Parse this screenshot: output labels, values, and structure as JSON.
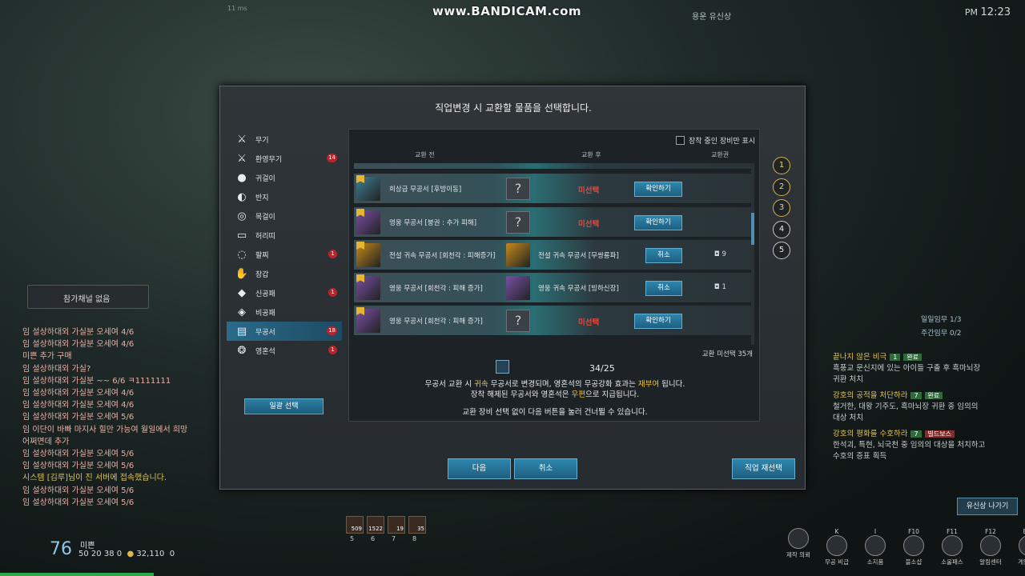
{
  "overlay": {
    "watermark": "www.BANDICAM.com",
    "zone": "용운 유신상",
    "clock": {
      "ampm": "PM",
      "time": "12:23"
    },
    "fps": "11 ms"
  },
  "chat": {
    "channel": "참가채널 없음",
    "lines": [
      {
        "text": "임 설상하대외 가실분 오세여 4/6",
        "type": "normal"
      },
      {
        "text": "임 설상하대외 가실분 오세여 4/6",
        "type": "normal"
      },
      {
        "text": "미쁜 추가 구매",
        "type": "normal"
      },
      {
        "text": "임 설상하대외 가실?",
        "type": "normal"
      },
      {
        "text": "임 설상하대외 가실분 ~~ 6/6 ㅋ1111111",
        "type": "normal"
      },
      {
        "text": "임 설상하대외 가실분 오세여 4/6",
        "type": "normal"
      },
      {
        "text": "임 설상하대외 가실분 오세여 4/6",
        "type": "normal"
      },
      {
        "text": "임 설상하대외 가실분 오세여 5/6",
        "type": "normal"
      },
      {
        "text": "임 이단이 바빠 마지사 힐만 가능여 월일에서 희망",
        "type": "normal"
      },
      {
        "text": "어쩌면데 추가",
        "type": "normal"
      },
      {
        "text": "임 설상하대외 가실분 오세여 5/6",
        "type": "normal"
      },
      {
        "text": "임 설상하대외 가실분 오세여 5/6",
        "type": "normal"
      },
      {
        "text": "시스템 [김루]님이 진 서버에 접속했습니다.",
        "type": "sys"
      },
      {
        "text": "임 설상하대외 가실분 오세여 5/6",
        "type": "normal"
      },
      {
        "text": "임 설상하대외 가실분 오세여 5/6",
        "type": "normal"
      }
    ]
  },
  "dialog": {
    "title": "직업변경 시 교환할 물품을 선택합니다.",
    "categories": [
      {
        "label": "무기",
        "icon": "sword-icon",
        "badge": ""
      },
      {
        "label": "환영무기",
        "icon": "phantom-sword-icon",
        "badge": "14"
      },
      {
        "label": "귀걸이",
        "icon": "earring-icon",
        "badge": ""
      },
      {
        "label": "반지",
        "icon": "ring-icon",
        "badge": ""
      },
      {
        "label": "목걸이",
        "icon": "necklace-icon",
        "badge": ""
      },
      {
        "label": "허리띠",
        "icon": "belt-icon",
        "badge": ""
      },
      {
        "label": "팔찌",
        "icon": "bracelet-icon",
        "badge": "1"
      },
      {
        "label": "장갑",
        "icon": "glove-icon",
        "badge": ""
      },
      {
        "label": "신공패",
        "icon": "talisman-icon",
        "badge": "1"
      },
      {
        "label": "비공패",
        "icon": "secret-talisman-icon",
        "badge": ""
      },
      {
        "label": "무공서",
        "icon": "book-icon",
        "badge": "18"
      },
      {
        "label": "영혼석",
        "icon": "soulstone-icon",
        "badge": "1"
      }
    ],
    "selected_category": "무공서",
    "bulk_select": "일괄 선택",
    "filter_label": "장착 중인 장비만 표시",
    "columns": {
      "before": "교환 전",
      "after": "교환 후",
      "ticket": "교환권"
    },
    "rows": [
      {
        "name": "희상급 무공서 [후방이동]",
        "before_color": "#3d7f96",
        "after_name": "",
        "after_color": "",
        "status": "미선택",
        "button": "확인하기",
        "ticket": ""
      },
      {
        "name": "영웅 무공서 [붕권 : 추가 피해]",
        "before_color": "#7a4fa6",
        "after_name": "",
        "after_color": "",
        "status": "미선택",
        "button": "확인하기",
        "ticket": ""
      },
      {
        "name": "전설 귀속 무공서 [회천각 : 피해증가]",
        "before_color": "#c48a1a",
        "after_name": "전설 귀속 무공서 [무쌍룡파]",
        "after_color": "#c48a1a",
        "status": "",
        "button": "취소",
        "ticket": "9"
      },
      {
        "name": "영웅 무공서 [회천각 : 피해 증가]",
        "before_color": "#7a4fa6",
        "after_name": "영웅 귀속 무공서 [빙하신장]",
        "after_color": "#7a4fa6",
        "status": "",
        "button": "취소",
        "ticket": "1"
      },
      {
        "name": "영웅 무공서 [회천각 : 피해 증가]",
        "before_color": "#7a4fa6",
        "after_name": "",
        "after_color": "",
        "status": "미선택",
        "button": "확인하기",
        "ticket": ""
      }
    ],
    "remaining": "교환 미선택 35개",
    "count": "34/25",
    "info": {
      "line1_a": "무공서 교환 시 ",
      "line1_b": "귀속",
      "line1_c": " 무공서로 변경되며, 영혼석의 무공강화 효과는 ",
      "line1_d": "재부여",
      "line1_e": " 됩니다.",
      "line2_a": "장착 해제된 무공서와 영혼석은 ",
      "line2_b": "우편",
      "line2_c": "으로 지급됩니다.",
      "line3": "교환 장비 선택 없이 다음 버튼을 눌러 건너뛸 수 있습니다."
    },
    "steps": [
      "1",
      "2",
      "3",
      "4",
      "5"
    ],
    "steps_done": [
      true,
      true,
      true,
      false,
      false
    ],
    "buttons": {
      "next": "다음",
      "cancel": "취소",
      "reselect": "직업 재선택"
    }
  },
  "quests": {
    "daily": "일일임무 1/3",
    "weekly": "주간임무 0/2",
    "items": [
      {
        "title": "끝나지 않은 비극",
        "tag": "1",
        "tag2": "완료",
        "desc1": "흑풍교 문신지에 있는 아이들 구출 후 흑마뇌장",
        "desc2": "귀환 처치"
      },
      {
        "title": "강호의 공적을 처단하라",
        "tag": "7",
        "tag2": "완료",
        "desc1": "철거한, 대왕 기주도, 흑마뇌장 귀환 중 임의의",
        "desc2": "대상 처치"
      },
      {
        "title": "강호의 평화를 수호하라",
        "tag": "7",
        "tag2": "빌드보스",
        "desc1": "한석괴, 특현, 뇌국천 중 임의의 대상을 처치하고",
        "desc2": "수호의 증표 획득"
      }
    ],
    "exit_label": "유신상 나가기"
  },
  "hud": {
    "level": "76",
    "player": "미쁜",
    "stats": {
      "a": "50",
      "b": "20",
      "c": "38",
      "d": "0",
      "gold": "32,110",
      "e": "0"
    },
    "skill_counts": [
      "509",
      "1522",
      "19",
      "35"
    ],
    "skill_keys": [
      "5",
      "6",
      "7",
      "8"
    ],
    "menu": [
      {
        "key": "",
        "label": "제작 의뢰"
      },
      {
        "key": "K",
        "label": "무공 비급"
      },
      {
        "key": "I",
        "label": "소지품"
      },
      {
        "key": "F10",
        "label": "블소샵"
      },
      {
        "key": "F11",
        "label": "소울패스"
      },
      {
        "key": "F12",
        "label": "알림센터"
      },
      {
        "key": "ESC",
        "label": "게임메뉴"
      }
    ]
  }
}
